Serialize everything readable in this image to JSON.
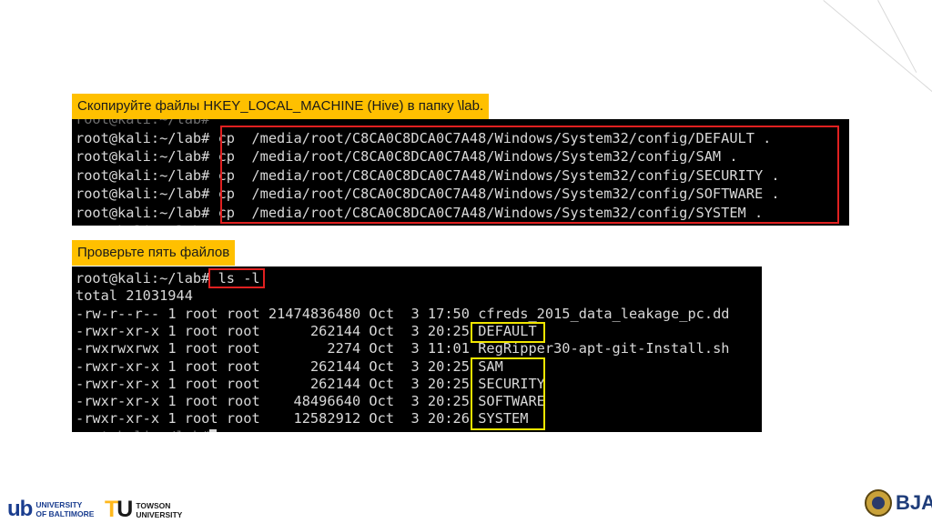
{
  "section1": {
    "label": "Скопируйте файлы HKEY_LOCAL_MACHINE (Hive) в папку \\lab.",
    "lines": [
      {
        "prompt": "root@kali:~/lab#",
        "cmd": "",
        "ghost": true
      },
      {
        "prompt": "root@kali:~/lab#",
        "cmd": " cp  /media/root/C8CA0C8DCA0C7A48/Windows/System32/config/DEFAULT ."
      },
      {
        "prompt": "root@kali:~/lab#",
        "cmd": " cp  /media/root/C8CA0C8DCA0C7A48/Windows/System32/config/SAM ."
      },
      {
        "prompt": "root@kali:~/lab#",
        "cmd": " cp  /media/root/C8CA0C8DCA0C7A48/Windows/System32/config/SECURITY ."
      },
      {
        "prompt": "root@kali:~/lab#",
        "cmd": " cp  /media/root/C8CA0C8DCA0C7A48/Windows/System32/config/SOFTWARE ."
      },
      {
        "prompt": "root@kali:~/lab#",
        "cmd": " cp  /media/root/C8CA0C8DCA0C7A48/Windows/System32/config/SYSTEM ."
      },
      {
        "prompt": "root@kali:~/lab#",
        "cmd": "",
        "ghost": true
      }
    ]
  },
  "section2": {
    "label": "Проверьте пять файлов",
    "prompt": "root@kali:~/lab#",
    "command": " ls -l",
    "total": "total 21031944",
    "rows": [
      {
        "perm": "-rw-r--r--",
        "links": "1",
        "owner": "root",
        "group": "root",
        "size": "21474836480",
        "month": "Oct",
        "day": "3",
        "time": "17:50",
        "name": "cfreds_2015_data_leakage_pc.dd"
      },
      {
        "perm": "-rwxr-xr-x",
        "links": "1",
        "owner": "root",
        "group": "root",
        "size": "262144",
        "month": "Oct",
        "day": "3",
        "time": "20:25",
        "name": "DEFAULT"
      },
      {
        "perm": "-rwxrwxrwx",
        "links": "1",
        "owner": "root",
        "group": "root",
        "size": "2274",
        "month": "Oct",
        "day": "3",
        "time": "11:01",
        "name": "RegRipper30-apt-git-Install.sh"
      },
      {
        "perm": "-rwxr-xr-x",
        "links": "1",
        "owner": "root",
        "group": "root",
        "size": "262144",
        "month": "Oct",
        "day": "3",
        "time": "20:25",
        "name": "SAM"
      },
      {
        "perm": "-rwxr-xr-x",
        "links": "1",
        "owner": "root",
        "group": "root",
        "size": "262144",
        "month": "Oct",
        "day": "3",
        "time": "20:25",
        "name": "SECURITY"
      },
      {
        "perm": "-rwxr-xr-x",
        "links": "1",
        "owner": "root",
        "group": "root",
        "size": "48496640",
        "month": "Oct",
        "day": "3",
        "time": "20:25",
        "name": "SOFTWARE"
      },
      {
        "perm": "-rwxr-xr-x",
        "links": "1",
        "owner": "root",
        "group": "root",
        "size": "12582912",
        "month": "Oct",
        "day": "3",
        "time": "20:26",
        "name": "SYSTEM"
      }
    ],
    "last_prompt": "root@kali:~/lab#"
  },
  "footer": {
    "ub_mark": "ub",
    "ub_line1": "UNIVERSITY",
    "ub_line2": "OF BALTIMORE",
    "tu_mark_t": "T",
    "tu_mark_u": "U",
    "tu_line1": "TOWSON",
    "tu_line2": "UNIVERSITY",
    "bja": "BJA"
  },
  "colors": {
    "label_bg": "#ffc000",
    "terminal_bg": "#000000",
    "highlight_red": "#e02020",
    "highlight_yellow": "#f2e600"
  }
}
